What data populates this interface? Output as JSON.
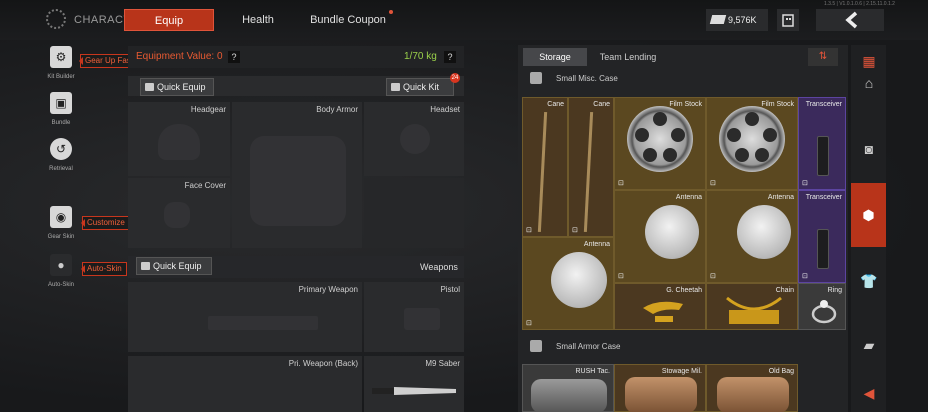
{
  "topbar": {
    "title": "CHARACTER",
    "tabs": [
      {
        "label": "Equip",
        "active": true
      },
      {
        "label": "Health",
        "active": false
      },
      {
        "label": "Bundle Coupon",
        "active": false,
        "notify": true
      }
    ],
    "currency": "9,576K",
    "back_icon": "chevron-left-icon",
    "build_text": "1.3.5 | V1.0.1.0.6 | 2.15.11.0.1.2"
  },
  "left_nav": {
    "items": [
      {
        "label": "Kit Builder",
        "icon": "kit-builder-icon",
        "tip": "Gear Up Fast"
      },
      {
        "label": "Bundle",
        "icon": "bundle-icon"
      },
      {
        "label": "Retrieval",
        "icon": "retrieval-icon"
      },
      {
        "label": "Gear Skin",
        "icon": "gear-skin-icon",
        "tip": "Customize"
      },
      {
        "label": "Auto-Skin",
        "icon": "auto-skin-icon",
        "tip": "Auto-Skin"
      }
    ]
  },
  "equipment": {
    "value_label": "Equipment Value: 0",
    "weight": "1/70 kg",
    "help": "?",
    "quick_equip_label": "Quick Equip",
    "quick_kit_label": "Quick Kit",
    "quick_kit_badge": "24",
    "slots": {
      "headgear": "Headgear",
      "body_armor": "Body Armor",
      "headset": "Headset",
      "face_cover": "Face Cover"
    },
    "weapons_quick_equip": "Quick Equip",
    "weapons_title": "Weapons",
    "weapon_slots": {
      "primary": "Primary Weapon",
      "pistol": "Pistol",
      "primary_back": "Pri. Weapon (Back)",
      "melee": "M9 Saber"
    }
  },
  "storage": {
    "tabs": [
      {
        "label": "Storage",
        "active": true
      },
      {
        "label": "Team Lending",
        "active": false
      }
    ],
    "case1": "Small Misc. Case",
    "case2": "Small Armor Case",
    "items": {
      "cane1": "Cane",
      "cane2": "Cane",
      "film1": "Film Stock",
      "film2": "Film Stock",
      "transceiver1": "Transceiver",
      "antenna1": "Antenna",
      "antenna2": "Antenna",
      "transceiver2": "Transceiver",
      "antenna3": "Antenna",
      "cheetah": "G. Cheetah",
      "chain": "Chain",
      "ring": "Ring",
      "rush": "RUSH Tac.",
      "mil": "Stowage Mil.",
      "oldbag": "Old Bag"
    },
    "expand": "⊡"
  },
  "right_nav": [
    "layout-icon",
    "home-icon",
    "camera-icon",
    "case-icon",
    "shirt-icon",
    "ammo-icon",
    "arrow-left-icon"
  ],
  "colors": {
    "accent": "#b8341a",
    "weight": "#9ad04a",
    "value": "#e85a32"
  }
}
